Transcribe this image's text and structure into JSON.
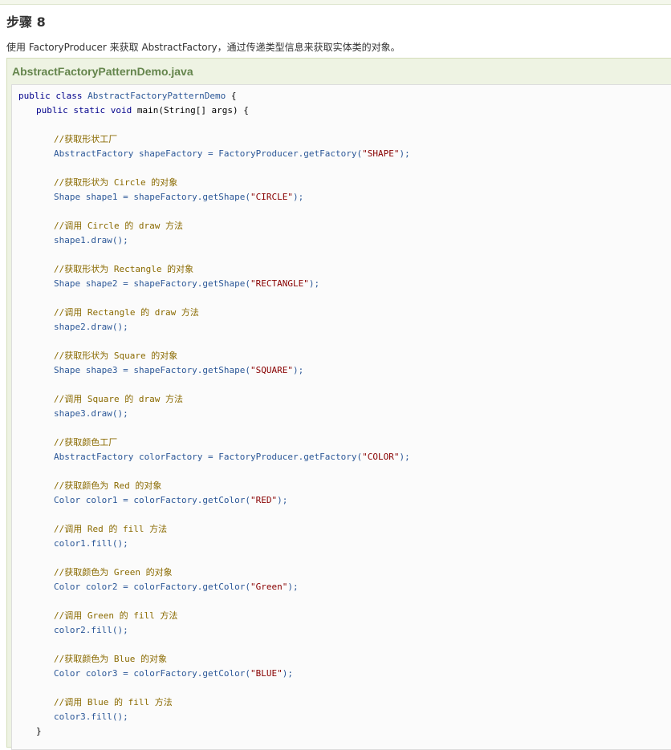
{
  "step_title": "步骤 8",
  "step_description": "使用 FactoryProducer 来获取 AbstractFactory，通过传递类型信息来获取实体类的对象。",
  "example": {
    "filename": "AbstractFactoryPatternDemo.java"
  },
  "colors": {
    "keyword": "#00008b",
    "type_identifier": "#2b5797",
    "string": "#880000",
    "comment": "#8a6a00",
    "title_green": "#64854c",
    "panel_bg": "#eef3e3"
  },
  "code_lines": [
    {
      "indent": 0,
      "tokens": [
        {
          "k": "kw",
          "t": "public class "
        },
        {
          "k": "ty",
          "t": "AbstractFactoryPatternDemo "
        },
        {
          "k": "pl",
          "t": "{"
        }
      ]
    },
    {
      "indent": 1,
      "tokens": [
        {
          "k": "kw",
          "t": "public static void "
        },
        {
          "k": "pl",
          "t": "main(String[] args) {"
        }
      ]
    },
    {
      "indent": 0,
      "tokens": []
    },
    {
      "indent": 2,
      "tokens": [
        {
          "k": "cm",
          "t": "//获取形状工厂"
        }
      ]
    },
    {
      "indent": 2,
      "tokens": [
        {
          "k": "ty",
          "t": "AbstractFactory shapeFactory = FactoryProducer.getFactory("
        },
        {
          "k": "st",
          "t": "\"SHAPE\""
        },
        {
          "k": "ty",
          "t": ");"
        }
      ]
    },
    {
      "indent": 0,
      "tokens": []
    },
    {
      "indent": 2,
      "tokens": [
        {
          "k": "cm",
          "t": "//获取形状为 Circle 的对象"
        }
      ]
    },
    {
      "indent": 2,
      "tokens": [
        {
          "k": "ty",
          "t": "Shape shape1 = shapeFactory.getShape("
        },
        {
          "k": "st",
          "t": "\"CIRCLE\""
        },
        {
          "k": "ty",
          "t": ");"
        }
      ]
    },
    {
      "indent": 0,
      "tokens": []
    },
    {
      "indent": 2,
      "tokens": [
        {
          "k": "cm",
          "t": "//调用 Circle 的 draw 方法"
        }
      ]
    },
    {
      "indent": 2,
      "tokens": [
        {
          "k": "ty",
          "t": "shape1.draw();"
        }
      ]
    },
    {
      "indent": 0,
      "tokens": []
    },
    {
      "indent": 2,
      "tokens": [
        {
          "k": "cm",
          "t": "//获取形状为 Rectangle 的对象"
        }
      ]
    },
    {
      "indent": 2,
      "tokens": [
        {
          "k": "ty",
          "t": "Shape shape2 = shapeFactory.getShape("
        },
        {
          "k": "st",
          "t": "\"RECTANGLE\""
        },
        {
          "k": "ty",
          "t": ");"
        }
      ]
    },
    {
      "indent": 0,
      "tokens": []
    },
    {
      "indent": 2,
      "tokens": [
        {
          "k": "cm",
          "t": "//调用 Rectangle 的 draw 方法"
        }
      ]
    },
    {
      "indent": 2,
      "tokens": [
        {
          "k": "ty",
          "t": "shape2.draw();"
        }
      ]
    },
    {
      "indent": 0,
      "tokens": []
    },
    {
      "indent": 2,
      "tokens": [
        {
          "k": "cm",
          "t": "//获取形状为 Square 的对象"
        }
      ]
    },
    {
      "indent": 2,
      "tokens": [
        {
          "k": "ty",
          "t": "Shape shape3 = shapeFactory.getShape("
        },
        {
          "k": "st",
          "t": "\"SQUARE\""
        },
        {
          "k": "ty",
          "t": ");"
        }
      ]
    },
    {
      "indent": 0,
      "tokens": []
    },
    {
      "indent": 2,
      "tokens": [
        {
          "k": "cm",
          "t": "//调用 Square 的 draw 方法"
        }
      ]
    },
    {
      "indent": 2,
      "tokens": [
        {
          "k": "ty",
          "t": "shape3.draw();"
        }
      ]
    },
    {
      "indent": 0,
      "tokens": []
    },
    {
      "indent": 2,
      "tokens": [
        {
          "k": "cm",
          "t": "//获取颜色工厂"
        }
      ]
    },
    {
      "indent": 2,
      "tokens": [
        {
          "k": "ty",
          "t": "AbstractFactory colorFactory = FactoryProducer.getFactory("
        },
        {
          "k": "st",
          "t": "\"COLOR\""
        },
        {
          "k": "ty",
          "t": ");"
        }
      ]
    },
    {
      "indent": 0,
      "tokens": []
    },
    {
      "indent": 2,
      "tokens": [
        {
          "k": "cm",
          "t": "//获取颜色为 Red 的对象"
        }
      ]
    },
    {
      "indent": 2,
      "tokens": [
        {
          "k": "ty",
          "t": "Color color1 = colorFactory.getColor("
        },
        {
          "k": "st",
          "t": "\"RED\""
        },
        {
          "k": "ty",
          "t": ");"
        }
      ]
    },
    {
      "indent": 0,
      "tokens": []
    },
    {
      "indent": 2,
      "tokens": [
        {
          "k": "cm",
          "t": "//调用 Red 的 fill 方法"
        }
      ]
    },
    {
      "indent": 2,
      "tokens": [
        {
          "k": "ty",
          "t": "color1.fill();"
        }
      ]
    },
    {
      "indent": 0,
      "tokens": []
    },
    {
      "indent": 2,
      "tokens": [
        {
          "k": "cm",
          "t": "//获取颜色为 Green 的对象"
        }
      ]
    },
    {
      "indent": 2,
      "tokens": [
        {
          "k": "ty",
          "t": "Color color2 = colorFactory.getColor("
        },
        {
          "k": "st",
          "t": "\"Green\""
        },
        {
          "k": "ty",
          "t": ");"
        }
      ]
    },
    {
      "indent": 0,
      "tokens": []
    },
    {
      "indent": 2,
      "tokens": [
        {
          "k": "cm",
          "t": "//调用 Green 的 fill 方法"
        }
      ]
    },
    {
      "indent": 2,
      "tokens": [
        {
          "k": "ty",
          "t": "color2.fill();"
        }
      ]
    },
    {
      "indent": 0,
      "tokens": []
    },
    {
      "indent": 2,
      "tokens": [
        {
          "k": "cm",
          "t": "//获取颜色为 Blue 的对象"
        }
      ]
    },
    {
      "indent": 2,
      "tokens": [
        {
          "k": "ty",
          "t": "Color color3 = colorFactory.getColor("
        },
        {
          "k": "st",
          "t": "\"BLUE\""
        },
        {
          "k": "ty",
          "t": ");"
        }
      ]
    },
    {
      "indent": 0,
      "tokens": []
    },
    {
      "indent": 2,
      "tokens": [
        {
          "k": "cm",
          "t": "//调用 Blue 的 fill 方法"
        }
      ]
    },
    {
      "indent": 2,
      "tokens": [
        {
          "k": "ty",
          "t": "color3.fill();"
        }
      ]
    },
    {
      "indent": 1,
      "tokens": [
        {
          "k": "pl",
          "t": "}"
        }
      ]
    }
  ]
}
